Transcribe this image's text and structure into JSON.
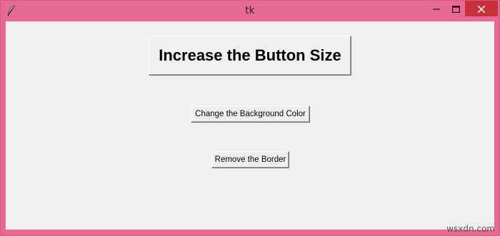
{
  "window": {
    "title": "tk",
    "icon": "feather-icon",
    "controls": {
      "minimize_icon": "minimize-icon",
      "maximize_icon": "maximize-icon",
      "close_icon": "close-icon"
    }
  },
  "buttons": {
    "increase_size": "Increase the Button Size",
    "change_background": "Change the Background Color",
    "remove_border": "Remove the Border"
  },
  "watermark": "wsxdn.com",
  "colors": {
    "titlebar": "#e66b93",
    "client_background": "#f0f0f0",
    "close_button": "#c8303a"
  }
}
